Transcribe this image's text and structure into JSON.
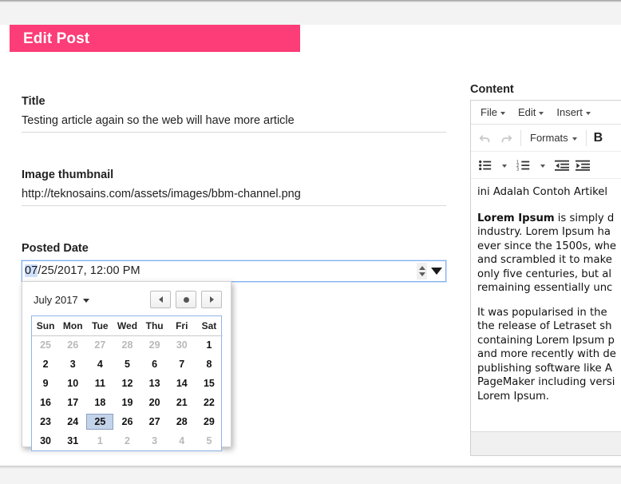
{
  "header": {
    "title": "Edit Post",
    "accent_color": "#fc3d77"
  },
  "form": {
    "title_field": {
      "label": "Title",
      "value": "Testing article again so the web will have more article"
    },
    "thumbnail_field": {
      "label": "Image thumbnail",
      "value": "http://teknosains.com/assets/images/bbm-channel.png"
    },
    "date_field": {
      "label": "Posted Date",
      "value_segment_month": "07",
      "value_rest": "/25/2017, 12:00 PM",
      "full_value": "07/25/2017, 12:00 PM"
    }
  },
  "calendar": {
    "month_label": "July 2017",
    "prev_label": "◂",
    "today_label": "●",
    "next_label": "▸",
    "weekdays": [
      "Sun",
      "Mon",
      "Tue",
      "Wed",
      "Thu",
      "Fri",
      "Sat"
    ],
    "selected_day": 25,
    "weeks": [
      [
        {
          "d": "25",
          "muted": true
        },
        {
          "d": "26",
          "muted": true
        },
        {
          "d": "27",
          "muted": true
        },
        {
          "d": "28",
          "muted": true
        },
        {
          "d": "29",
          "muted": true
        },
        {
          "d": "30",
          "muted": true
        },
        {
          "d": "1",
          "muted": false
        }
      ],
      [
        {
          "d": "2",
          "muted": false
        },
        {
          "d": "3",
          "muted": false
        },
        {
          "d": "4",
          "muted": false
        },
        {
          "d": "5",
          "muted": false
        },
        {
          "d": "6",
          "muted": false
        },
        {
          "d": "7",
          "muted": false
        },
        {
          "d": "8",
          "muted": false
        }
      ],
      [
        {
          "d": "9",
          "muted": false
        },
        {
          "d": "10",
          "muted": false
        },
        {
          "d": "11",
          "muted": false
        },
        {
          "d": "12",
          "muted": false
        },
        {
          "d": "13",
          "muted": false
        },
        {
          "d": "14",
          "muted": false
        },
        {
          "d": "15",
          "muted": false
        }
      ],
      [
        {
          "d": "16",
          "muted": false
        },
        {
          "d": "17",
          "muted": false
        },
        {
          "d": "18",
          "muted": false
        },
        {
          "d": "19",
          "muted": false
        },
        {
          "d": "20",
          "muted": false
        },
        {
          "d": "21",
          "muted": false
        },
        {
          "d": "22",
          "muted": false
        }
      ],
      [
        {
          "d": "23",
          "muted": false
        },
        {
          "d": "24",
          "muted": false
        },
        {
          "d": "25",
          "muted": false,
          "selected": true
        },
        {
          "d": "26",
          "muted": false
        },
        {
          "d": "27",
          "muted": false
        },
        {
          "d": "28",
          "muted": false
        },
        {
          "d": "29",
          "muted": false
        }
      ],
      [
        {
          "d": "30",
          "muted": false
        },
        {
          "d": "31",
          "muted": false
        },
        {
          "d": "1",
          "muted": true
        },
        {
          "d": "2",
          "muted": true
        },
        {
          "d": "3",
          "muted": true
        },
        {
          "d": "4",
          "muted": true
        },
        {
          "d": "5",
          "muted": true
        }
      ]
    ]
  },
  "content": {
    "label": "Content",
    "menubar": [
      "File",
      "Edit",
      "Insert"
    ],
    "toolbar": {
      "undo": "undo-icon",
      "redo": "redo-icon",
      "formats": "Formats",
      "bold": "B",
      "bullet_list": "bullet-list-icon",
      "numbered_list": "numbered-list-icon",
      "outdent": "outdent-icon",
      "indent": "indent-icon"
    },
    "paragraphs": [
      "ini Adalah Contoh Artikel",
      "Lorem Ipsum is simply d",
      "industry. Lorem Ipsum ha",
      "ever since the 1500s, whe",
      "and scrambled it to make",
      "only five centuries, but al",
      "remaining essentially unc",
      "It was popularised in the",
      "the release of Letraset sh",
      "containing Lorem Ipsum p",
      "and more recently with de",
      "publishing software like A",
      "PageMaker including versi",
      "Lorem Ipsum."
    ],
    "bold_lead": "Lorem Ipsum"
  }
}
